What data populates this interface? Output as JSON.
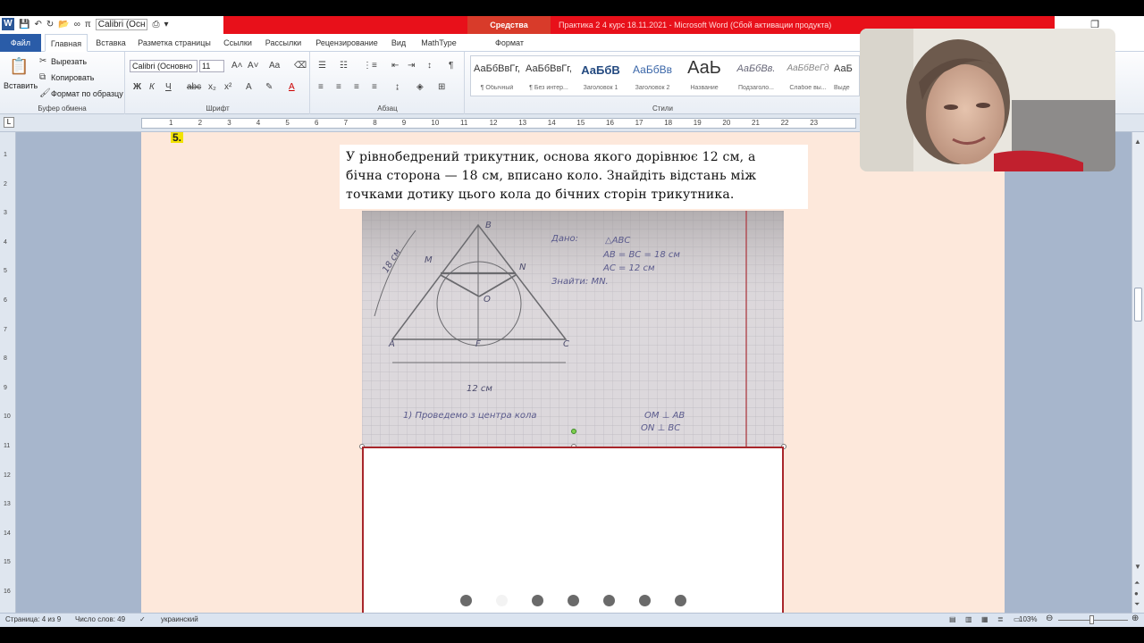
{
  "qat": {
    "font_box": "Calibri (Осн"
  },
  "title": {
    "context_tab": "Средства рисования",
    "window_title": "Практика 2  4 курс  18.11.2021  -  Microsoft Word (Сбой активации продукта)"
  },
  "tabs": [
    "Файл",
    "Главная",
    "Вставка",
    "Разметка страницы",
    "Ссылки",
    "Рассылки",
    "Рецензирование",
    "Вид",
    "MathType",
    "Формат"
  ],
  "ribbon": {
    "paste": "Вставить",
    "cut": "Вырезать",
    "copy": "Копировать",
    "format_painter": "Формат по образцу",
    "clipboard_group": "Буфер обмена",
    "font_name": "Calibri (Основно",
    "font_size": "11",
    "font_group": "Шрифт",
    "paragraph_group": "Абзац",
    "styles_group": "Стили",
    "styles": [
      {
        "sample": "АаБбВвГг,",
        "name": "¶ Обычный"
      },
      {
        "sample": "АаБбВвГг,",
        "name": "¶ Без интер..."
      },
      {
        "sample": "АаБбВ",
        "name": "Заголовок 1"
      },
      {
        "sample": "АаБбВв",
        "name": "Заголовок 2"
      },
      {
        "sample": "АаЬ",
        "name": "Название"
      },
      {
        "sample": "АаБбВв.",
        "name": "Подзаголо..."
      },
      {
        "sample": "АаБбВеГд",
        "name": "Слабое вы..."
      },
      {
        "sample": "АаБ",
        "name": "Выде"
      }
    ]
  },
  "ruler_numbers": [
    "1",
    "2",
    "3",
    "4",
    "5",
    "6",
    "7",
    "8",
    "9",
    "10",
    "11",
    "12",
    "13",
    "14",
    "15",
    "16",
    "17",
    "18",
    "19",
    "20",
    "21",
    "22",
    "23"
  ],
  "vruler_numbers": [
    "1",
    "2",
    "3",
    "4",
    "5",
    "6",
    "7",
    "8",
    "9",
    "10",
    "11",
    "12",
    "13",
    "14",
    "15",
    "16"
  ],
  "document": {
    "number": "5.",
    "problem_lines": [
      "У рівнобедрений трикутник, основа якого дорівнює 12 см, а",
      "бічна сторона — 18 см, вписано коло. Знайдіть відстань між",
      "точками дотику цього кола до бічних сторін трикутника."
    ],
    "sketch": {
      "vertex_labels": [
        "B",
        "A",
        "C",
        "M",
        "N",
        "O",
        "F"
      ],
      "side_label": "18 см",
      "base_label": "12 см",
      "given_title": "Дано:",
      "given_lines": [
        "△ABC",
        "AB = BC = 18 см",
        "AC = 12 см"
      ],
      "find_line": "Знайти: MN.",
      "step_line": "1)  Проведемо  з  центра  кола",
      "perp_lines": [
        "OM ⊥ AB",
        "ON ⊥ BC"
      ]
    },
    "carousel_active_index": 1
  },
  "status": {
    "page": "Страница: 4 из 9",
    "words": "Число слов: 49",
    "language": "украинский",
    "zoom": "103%"
  }
}
